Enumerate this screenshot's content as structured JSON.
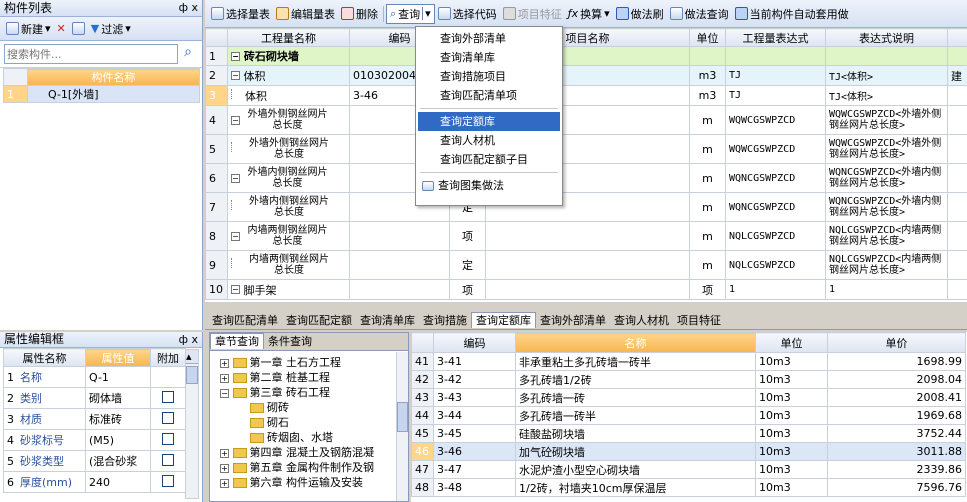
{
  "left_panel": {
    "title": "构件列表",
    "pin": "ф",
    "close": "x",
    "new_label": "新建",
    "filter_label": "过滤",
    "search_placeholder": "搜索构件...",
    "header": "构件名称",
    "rows": [
      {
        "num": "1",
        "name": "Q-1[外墙]"
      }
    ]
  },
  "prop_panel": {
    "title": "属性编辑框",
    "headers": [
      "属性名称",
      "属性值",
      "附加"
    ],
    "rows": [
      {
        "num": "1",
        "name": "名称",
        "value": "Q-1",
        "chk": false
      },
      {
        "num": "2",
        "name": "类别",
        "value": "砌体墙",
        "chk": true
      },
      {
        "num": "3",
        "name": "材质",
        "value": "标准砖",
        "chk": true
      },
      {
        "num": "4",
        "name": "砂浆标号",
        "value": "(M5)",
        "chk": true
      },
      {
        "num": "5",
        "name": "砂浆类型",
        "value": "(混合砂浆",
        "chk": true
      },
      {
        "num": "6",
        "name": "厚度(mm)",
        "value": "240",
        "chk": true
      }
    ]
  },
  "toolbar": {
    "items": [
      "选择量表",
      "编辑量表",
      "删除",
      "查询",
      "选择代码",
      "项目特征",
      "换算",
      "做法刷",
      "做法查询",
      "当前构件自动套用做"
    ]
  },
  "main_table": {
    "headers": [
      "工程量名称",
      "编码",
      "类别",
      "项目名称",
      "单位",
      "工程量表达式",
      "表达式说明"
    ],
    "rows": [
      {
        "n": "1",
        "name": "砖石砌块墙",
        "code": "",
        "type": "",
        "unit": "",
        "expr": "",
        "desc": ""
      },
      {
        "n": "2",
        "name": "体积",
        "code": "010302004",
        "type": "",
        "unit": "m3",
        "expr": "TJ",
        "desc": "TJ<体积>",
        "extra": "建"
      },
      {
        "n": "3",
        "name": "体积",
        "code": "3-46",
        "type": "",
        "unit": "m3",
        "expr": "TJ",
        "desc": "TJ<体积>"
      },
      {
        "n": "4",
        "name": "外墙外侧钢丝网片总长度",
        "code": "",
        "type": "",
        "unit": "m",
        "expr": "WQWCGSWPZCD",
        "desc": "WQWCGSWPZCD<外墙外侧钢丝网片总长度>"
      },
      {
        "n": "5",
        "name": "外墙外侧钢丝网片总长度",
        "code": "",
        "type": "",
        "unit": "m",
        "expr": "WQWCGSWPZCD",
        "desc": "WQWCGSWPZCD<外墙外侧钢丝网片总长度>"
      },
      {
        "n": "6",
        "name": "外墙内侧钢丝网片总长度",
        "code": "",
        "type": "",
        "unit": "m",
        "expr": "WQNCGSWPZCD",
        "desc": "WQNCGSWPZCD<外墙内侧钢丝网片总长度>"
      },
      {
        "n": "7",
        "name": "外墙内侧钢丝网片总长度",
        "code": "",
        "type": "定",
        "unit": "m",
        "expr": "WQNCGSWPZCD",
        "desc": "WQNCGSWPZCD<外墙内侧钢丝网片总长度>"
      },
      {
        "n": "8",
        "name": "内墙两侧钢丝网片总长度",
        "code": "",
        "type": "项",
        "unit": "m",
        "expr": "NQLCGSWPZCD",
        "desc": "NQLCGSWPZCD<内墙两侧钢丝网片总长度>"
      },
      {
        "n": "9",
        "name": "内墙两侧钢丝网片总长度",
        "code": "",
        "type": "定",
        "unit": "m",
        "expr": "NQLCGSWPZCD",
        "desc": "NQLCGSWPZCD<内墙两侧钢丝网片总长度>"
      },
      {
        "n": "10",
        "name": "脚手架",
        "code": "",
        "type": "项",
        "unit": "项",
        "expr": "1",
        "desc": "1"
      }
    ]
  },
  "dropdown": {
    "items": [
      "查询外部清单",
      "查询清单库",
      "查询措施项目",
      "查询匹配清单项",
      "查询定额库",
      "查询人材机",
      "查询匹配定额子目",
      "查询图集做法"
    ]
  },
  "bottom_tabs": [
    "查询匹配清单",
    "查询匹配定额",
    "查询清单库",
    "查询措施",
    "查询定额库",
    "查询外部清单",
    "查询人材机",
    "项目特征"
  ],
  "tree": {
    "tabs": [
      "章节查询",
      "条件查询"
    ],
    "items": [
      "第一章 土石方工程",
      "第二章 桩基工程",
      "第三章 砖石工程",
      "砌砖",
      "砌石",
      "砖烟囱、水塔",
      "第四章 混凝土及钢筋混凝",
      "第五章 金属构件制作及钢",
      "第六章 构件运输及安装"
    ]
  },
  "quota": {
    "headers": [
      "编码",
      "名称",
      "单位",
      "单价"
    ],
    "rows": [
      {
        "n": "41",
        "code": "3-41",
        "name": "非承重粘土多孔砖墙一砖半",
        "unit": "10m3",
        "price": "1698.99"
      },
      {
        "n": "42",
        "code": "3-42",
        "name": "多孔砖墙1/2砖",
        "unit": "10m3",
        "price": "2098.04"
      },
      {
        "n": "43",
        "code": "3-43",
        "name": "多孔砖墙一砖",
        "unit": "10m3",
        "price": "2008.41"
      },
      {
        "n": "44",
        "code": "3-44",
        "name": "多孔砖墙一砖半",
        "unit": "10m3",
        "price": "1969.68"
      },
      {
        "n": "45",
        "code": "3-45",
        "name": "硅酸盐砌块墙",
        "unit": "10m3",
        "price": "3752.44"
      },
      {
        "n": "46",
        "code": "3-46",
        "name": "加气砼砌块墙",
        "unit": "10m3",
        "price": "3011.88"
      },
      {
        "n": "47",
        "code": "3-47",
        "name": "水泥炉渣小型空心砌块墙",
        "unit": "10m3",
        "price": "2339.86"
      },
      {
        "n": "48",
        "code": "3-48",
        "name": "1/2砖，衬墙夹10cm厚保温层",
        "unit": "10m3",
        "price": "7596.76"
      }
    ]
  }
}
